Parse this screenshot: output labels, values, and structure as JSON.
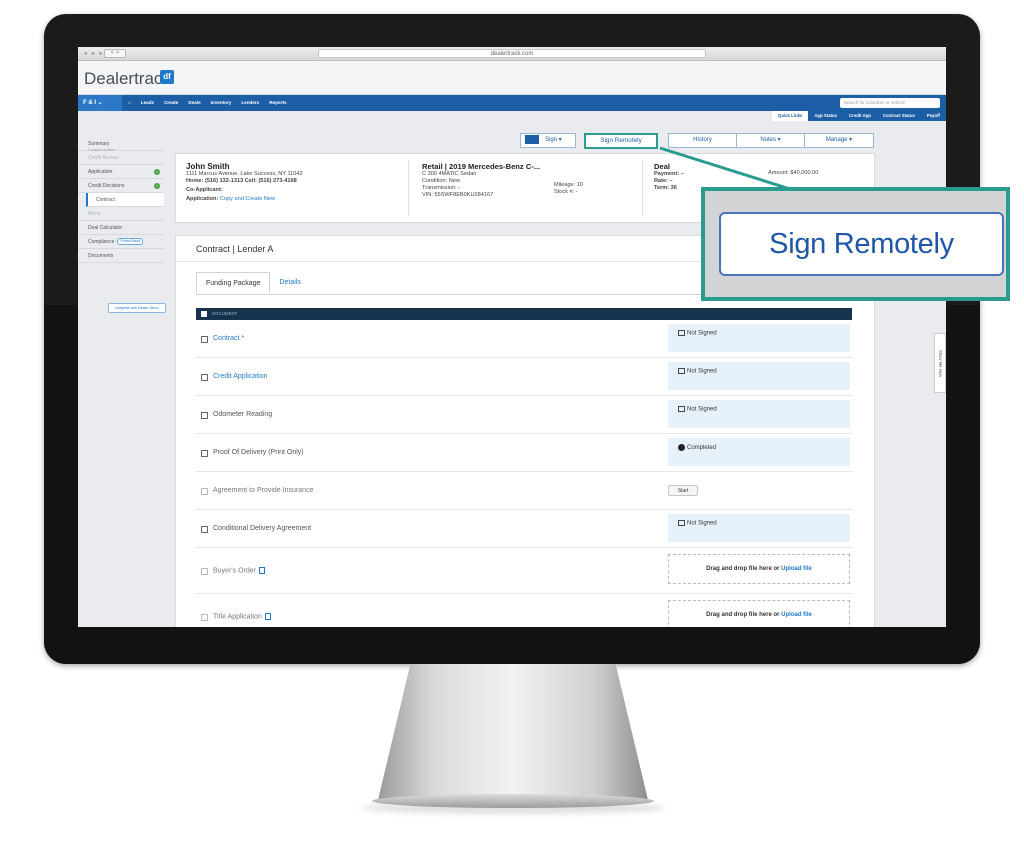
{
  "browser": {
    "url": "dealertrack.com",
    "traffic": "● ● ●",
    "nav_arrows": "< >"
  },
  "brand": {
    "name": "Dealertrack",
    "badge": "df"
  },
  "nav": {
    "module": "F & I",
    "items": [
      "Leads",
      "Create",
      "Deals",
      "Inventory",
      "Lenders",
      "Reports"
    ],
    "search_placeholder": "Search for customer or vehicle"
  },
  "quicklinks": [
    "Quick Links",
    "App Status",
    "Credit App",
    "Contract Status",
    "Payoff"
  ],
  "sidebar": {
    "items": [
      {
        "label": "Summary",
        "sub": "Contract Verified",
        "state": "normal"
      },
      {
        "label": "Credit Bureau",
        "state": "muted"
      },
      {
        "label": "Application",
        "state": "checked"
      },
      {
        "label": "Credit Decisions",
        "state": "checked"
      },
      {
        "label": "Contract",
        "state": "active"
      },
      {
        "label": "Menu",
        "state": "muted"
      },
      {
        "label": "Deal Calculator",
        "state": "normal"
      },
      {
        "label": "Compliance",
        "pill": "Protect Basic",
        "state": "normal"
      },
      {
        "label": "Documents",
        "state": "normal"
      }
    ],
    "integrate_label": "Integrate with Dealer Menu"
  },
  "actions": {
    "sign": "Sign ▾",
    "sign_remotely": "Sign Remotely",
    "history": "History",
    "notes": "Notes ▾",
    "manage": "Manage ▾"
  },
  "deal_card": {
    "customer_name": "John Smith",
    "address": "1111 Marcus Avenue, Lake Success, NY 11042",
    "phones": "Home: (516) 132-1313 Cell: (516) 273-4168",
    "co_applicant": "Co-Applicant:",
    "application_label": "Application:",
    "application_link": "Copy and Create New",
    "vehicle_title": "Retail | 2019 Mercedes-Benz C-...",
    "vehicle_model": "C 300 4MATIC Sedan",
    "condition": "Condition: New",
    "transmission": "Transmission: -",
    "vin": "VIN: 55SWF8EB0KU284167",
    "mileage": "Mileage: 10",
    "stock": "Stock #: -",
    "deal_title": "Deal",
    "payment": "Payment: –",
    "rate": "Rate: –",
    "term": "Term: 36",
    "amount": "Amount: $40,000.00"
  },
  "contract": {
    "title": "Contract | Lender A",
    "tabs": [
      "Funding Package",
      "Details"
    ],
    "header": "DOCUMENT",
    "documents": [
      {
        "name": "Contract *",
        "style": "link",
        "status": "Not Signed",
        "kind": "status"
      },
      {
        "name": "Credit Application",
        "style": "link",
        "status": "Not Signed",
        "kind": "status"
      },
      {
        "name": "Odometer Reading",
        "style": "normal",
        "status": "Not Signed",
        "kind": "status"
      },
      {
        "name": "Proof Of Delivery (Print Only)",
        "style": "normal",
        "status": "Completed",
        "kind": "completed"
      },
      {
        "name": "Agreement to Provide Insurance",
        "style": "muted",
        "status": "Start",
        "kind": "start"
      },
      {
        "name": "Conditional Delivery Agreement",
        "style": "normal",
        "status": "Not Signed",
        "kind": "status"
      },
      {
        "name": "Buyer's Order",
        "style": "muted",
        "status": "Drag and drop file here or",
        "link": "Upload file",
        "kind": "upload"
      },
      {
        "name": "Title Application",
        "style": "muted",
        "status": "Drag and drop file here or",
        "link": "Upload file",
        "kind": "upload"
      }
    ]
  },
  "side_tab": "Show Me How",
  "callout": {
    "label": "Sign Remotely",
    "accent": "#2a9b8f"
  }
}
